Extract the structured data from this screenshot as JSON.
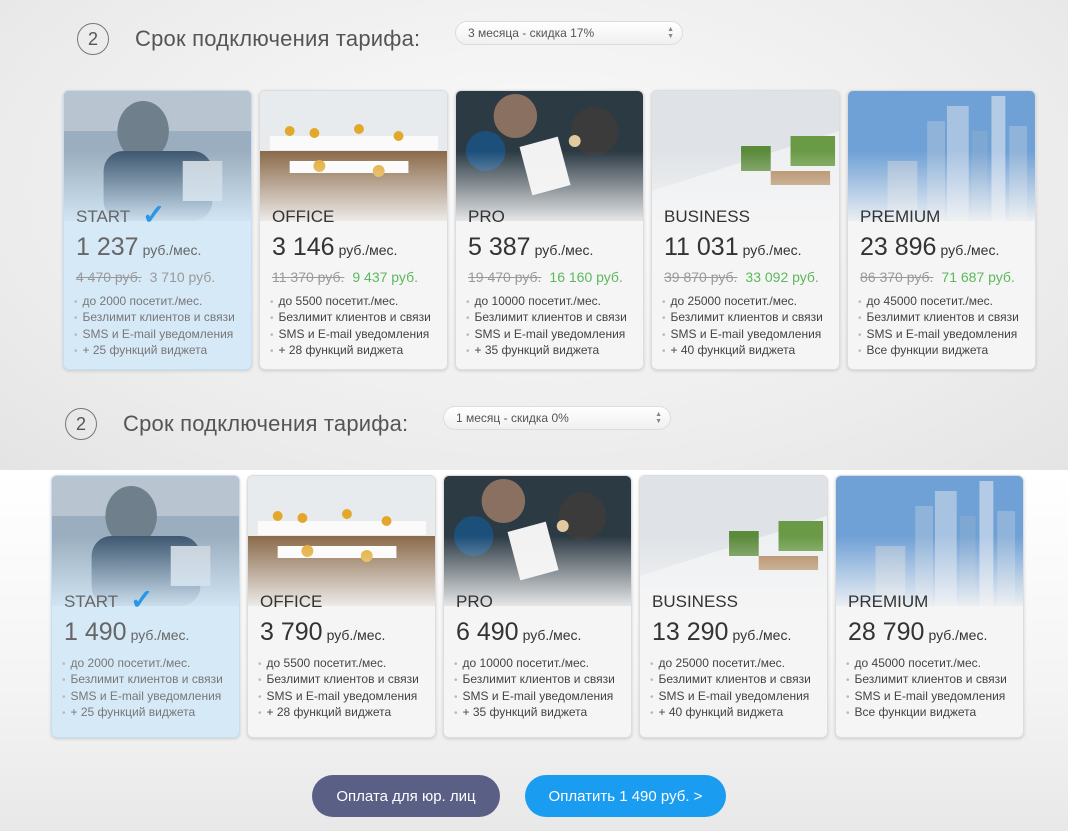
{
  "section_a": {
    "step_number": "2",
    "step_title": "Срок подключения тарифа:",
    "period_select": "3 месяца - скидка 17%",
    "plans": [
      {
        "name": "START",
        "selected": true,
        "price": "1 237",
        "unit": "руб./мес.",
        "old_price": "4 470 руб.",
        "new_price": "3 710 руб.",
        "features": [
          "до 2000 посетит./мес.",
          "Безлимит клиентов и связи",
          "SMS и E-mail уведомления",
          "+ 25 функций виджета"
        ]
      },
      {
        "name": "OFFICE",
        "selected": false,
        "price": "3 146",
        "unit": "руб./мес.",
        "old_price": "11 370 руб.",
        "new_price": "9 437 руб.",
        "features": [
          "до 5500 посетит./мес.",
          "Безлимит клиентов и связи",
          "SMS и E-mail уведомления",
          "+ 28 функций виджета"
        ]
      },
      {
        "name": "PRO",
        "selected": false,
        "price": "5 387",
        "unit": "руб./мес.",
        "old_price": "19 470 руб.",
        "new_price": "16 160 руб.",
        "features": [
          "до 10000 посетит./мес.",
          "Безлимит клиентов и связи",
          "SMS и E-mail уведомления",
          "+ 35 функций виджета"
        ]
      },
      {
        "name": "BUSINESS",
        "selected": false,
        "price": "11 031",
        "unit": "руб./мес.",
        "old_price": "39 870 руб.",
        "new_price": "33 092 руб.",
        "features": [
          "до 25000 посетит./мес.",
          "Безлимит клиентов и связи",
          "SMS и E-mail уведомления",
          "+ 40 функций виджета"
        ]
      },
      {
        "name": "PREMIUM",
        "selected": false,
        "price": "23 896",
        "unit": "руб./мес.",
        "old_price": "86 370 руб.",
        "new_price": "71 687 руб.",
        "features": [
          "до 45000 посетит./мес.",
          "Безлимит клиентов и связи",
          "SMS и E-mail уведомления",
          "Все функции виджета"
        ]
      }
    ]
  },
  "section_b": {
    "step_number": "2",
    "step_title": "Срок подключения тарифа:",
    "period_select": "1 месяц - скидка 0%",
    "plans": [
      {
        "name": "START",
        "selected": true,
        "price": "1 490",
        "unit": "руб./мес.",
        "features": [
          "до 2000 посетит./мес.",
          "Безлимит клиентов и связи",
          "SMS и E-mail уведомления",
          "+ 25 функций виджета"
        ]
      },
      {
        "name": "OFFICE",
        "selected": false,
        "price": "3 790",
        "unit": "руб./мес.",
        "features": [
          "до 5500 посетит./мес.",
          "Безлимит клиентов и связи",
          "SMS и E-mail уведомления",
          "+ 28 функций виджета"
        ]
      },
      {
        "name": "PRO",
        "selected": false,
        "price": "6 490",
        "unit": "руб./мес.",
        "features": [
          "до 10000 посетит./мес.",
          "Безлимит клиентов и связи",
          "SMS и E-mail уведомления",
          "+ 35 функций виджета"
        ]
      },
      {
        "name": "BUSINESS",
        "selected": false,
        "price": "13 290",
        "unit": "руб./мес.",
        "features": [
          "до 25000 посетит./мес.",
          "Безлимит клиентов и связи",
          "SMS и E-mail уведомления",
          "+ 40 функций виджета"
        ]
      },
      {
        "name": "PREMIUM",
        "selected": false,
        "price": "28 790",
        "unit": "руб./мес.",
        "features": [
          "до 45000 посетит./мес.",
          "Безлимит клиентов и связи",
          "SMS и E-mail уведомления",
          "Все функции виджета"
        ]
      }
    ]
  },
  "buttons": {
    "legal_entity": "Оплата для юр. лиц",
    "pay": "Оплатить 1 490 руб. >"
  },
  "colors": {
    "accent": "#1a9cf0",
    "legal_button": "#5a5f85",
    "discount_green": "#5cb85c",
    "selected_card": "#d6e9f7"
  },
  "icons": {
    "selected_mark": "checkmark-icon",
    "select_arrows": "select-arrows-icon"
  }
}
